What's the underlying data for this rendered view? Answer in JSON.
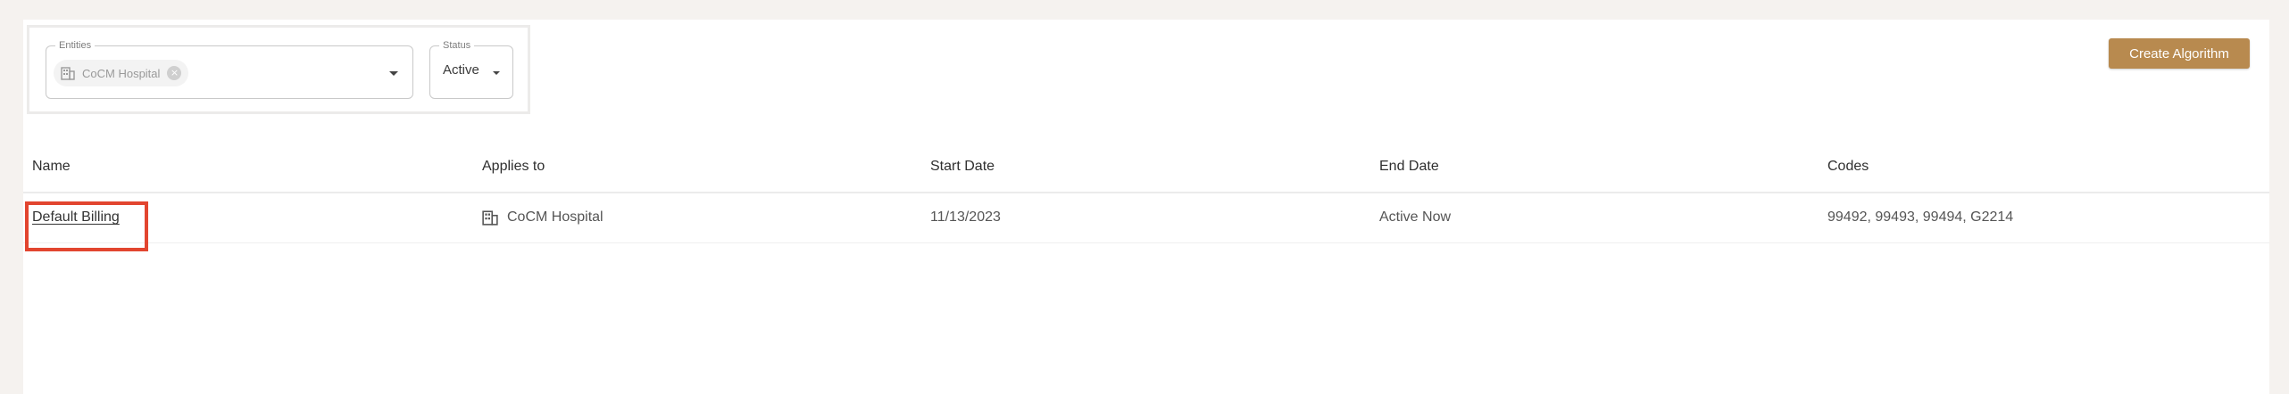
{
  "filters": {
    "entities": {
      "legend": "Entities",
      "chip_label": "CoCM Hospital",
      "chip_icon": "building-icon",
      "remove_icon": "close-circle-icon"
    },
    "status": {
      "legend": "Status",
      "value": "Active"
    }
  },
  "actions": {
    "create_label": "Create Algorithm"
  },
  "table": {
    "columns": [
      "Name",
      "Applies to",
      "Start Date",
      "End Date",
      "Codes"
    ],
    "rows": [
      {
        "name": "Default Billing",
        "applies_to": "CoCM Hospital",
        "applies_icon": "building-icon",
        "start_date": "11/13/2023",
        "end_date": "Active Now",
        "codes": "99492, 99493, 99494, G2214"
      }
    ]
  },
  "colors": {
    "accent": "#b88a4f",
    "highlight": "#e2452f",
    "background": "#f5f2ef"
  }
}
